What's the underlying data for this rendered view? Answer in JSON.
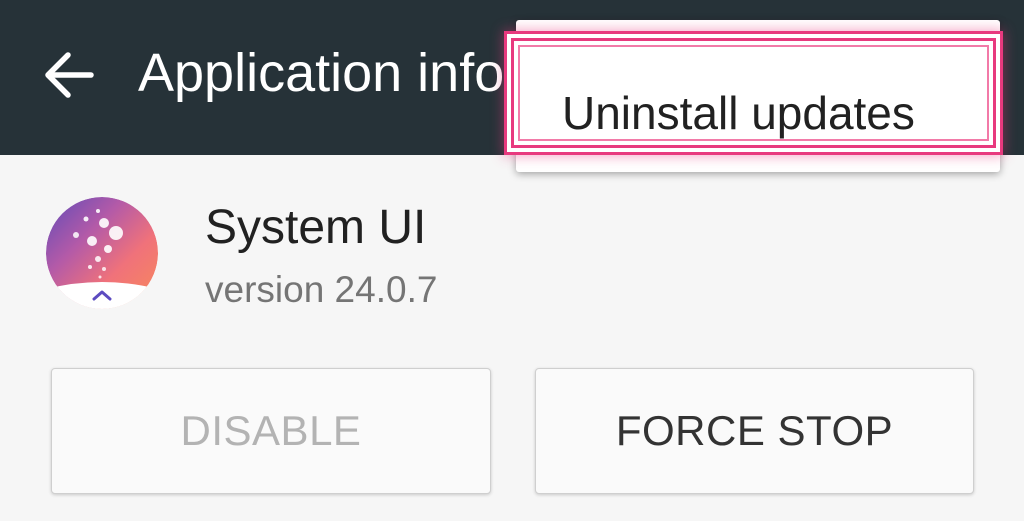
{
  "toolbar": {
    "title": "Application info",
    "background": "#263238",
    "back_icon": "arrow-back-icon"
  },
  "overflow_menu": {
    "items": [
      {
        "label": "Uninstall updates",
        "highlighted": true
      }
    ],
    "highlight_color": "#e8397e"
  },
  "app": {
    "name": "System UI",
    "version": "version 24.0.7",
    "icon": "system-ui-app-icon"
  },
  "buttons": {
    "disable": {
      "label": "DISABLE",
      "enabled": false
    },
    "force_stop": {
      "label": "FORCE STOP",
      "enabled": true
    }
  }
}
